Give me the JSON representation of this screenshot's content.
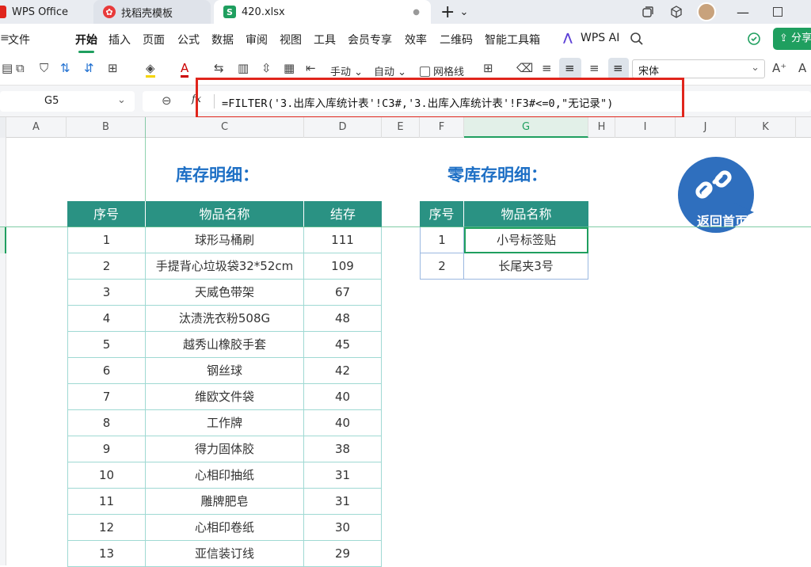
{
  "tabs": {
    "wps": "WPS Office",
    "template": "找稻壳模板",
    "file": "420.xlsx",
    "dot": "●",
    "plus": "+",
    "chevron": "⌄"
  },
  "menu": {
    "file": "文件",
    "items": [
      "开始",
      "插入",
      "页面",
      "公式",
      "数据",
      "审阅",
      "视图",
      "工具",
      "会员专享",
      "效率",
      "二维码",
      "智能工具箱"
    ],
    "wps_ai": "WPS AI",
    "share": "分享"
  },
  "toolbar": {
    "manual": "手动",
    "auto": "自动",
    "gridlines": "网格线",
    "font": "宋体"
  },
  "formula_bar": {
    "cell": "G5",
    "fx": "fx",
    "formula": "=FILTER('3.出库入库统计表'!C3#,'3.出库入库统计表'!F3#<=0,\"无记录\")"
  },
  "columns": [
    "A",
    "B",
    "C",
    "D",
    "E",
    "F",
    "G",
    "H",
    "I",
    "J",
    "K"
  ],
  "sheet": {
    "title_left": "库存明细：",
    "title_right": "零库存明细：",
    "back_home": "返回首页",
    "inventory": {
      "headers": [
        "序号",
        "物品名称",
        "结存"
      ],
      "rows": [
        [
          "1",
          "球形马桶刷",
          "111"
        ],
        [
          "2",
          "手提背心垃圾袋32*52cm",
          "109"
        ],
        [
          "3",
          "天威色带架",
          "67"
        ],
        [
          "4",
          "汰渍洗衣粉508G",
          "48"
        ],
        [
          "5",
          "越秀山橡胶手套",
          "45"
        ],
        [
          "6",
          "钢丝球",
          "42"
        ],
        [
          "7",
          "维欧文件袋",
          "40"
        ],
        [
          "8",
          "工作牌",
          "40"
        ],
        [
          "9",
          "得力固体胶",
          "38"
        ],
        [
          "10",
          "心相印抽纸",
          "31"
        ],
        [
          "11",
          "雕牌肥皂",
          "31"
        ],
        [
          "12",
          "心相印卷纸",
          "30"
        ],
        [
          "13",
          "亚信装订线",
          "29"
        ]
      ]
    },
    "zero_stock": {
      "headers": [
        "序号",
        "物品名称"
      ],
      "rows": [
        [
          "1",
          "小号标签贴"
        ],
        [
          "2",
          "长尾夹3号"
        ]
      ]
    }
  },
  "colors": {
    "header_teal": "#2a9283",
    "title_blue": "#1d6fc5",
    "accent_green": "#1f9f5f",
    "highlight_red": "#e0251c"
  }
}
